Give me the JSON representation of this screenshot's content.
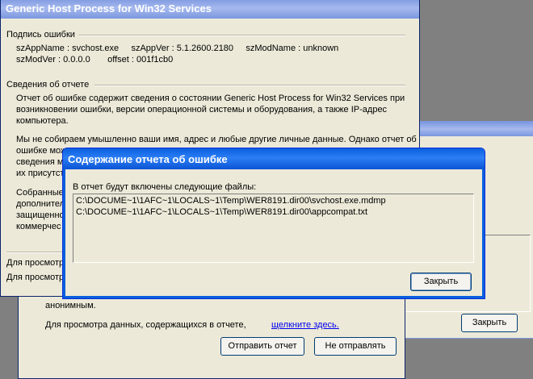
{
  "back_window_right": {
    "close_button": "Закрыть"
  },
  "middle_window": {
    "anonymous_text": "анонимным.",
    "view_data_text": "Для просмотра данных, содержащихся в отчете,",
    "click_here_link": "щелкните здесь.",
    "send_button": "Отправить отчет",
    "dont_send_button": "Не отправлять"
  },
  "main_window": {
    "title": "Generic Host Process for Win32 Services",
    "signature_header": "Подпись ошибки",
    "sig_line1": "szAppName : svchost.exe     szAppVer : 5.1.2600.2180     szModName : unknown",
    "sig_line2": "szModVer : 0.0.0.0       offset : 001f1cb0",
    "report_header": "Сведения об отчете",
    "report_p1": [
      "Отчет об ошибке содержит сведения о состоянии Generic Host Process for Win32 Services при",
      "возникновении ошибки, версии операционной системы и оборудования, а также IP-адрес",
      "компьютера."
    ],
    "report_p2": [
      "Мы не собираем умышленно ваши имя, адрес и любые другие личные данные. Однако отчет об",
      "ошибке мож",
      "сведения м",
      "их присутст"
    ],
    "report_p3": [
      "Собранные",
      "дополнител",
      "защищенно",
      "коммерчес"
    ],
    "view_line1": "Для просмотр",
    "view_line2": "Для просмотр"
  },
  "dialog": {
    "title": "Содержание отчета об ошибке",
    "files_label": "В отчет будут включены следующие файлы:",
    "files": [
      "C:\\DOCUME~1\\1AFC~1\\LOCALS~1\\Temp\\WER8191.dir00\\svchost.exe.mdmp",
      "C:\\DOCUME~1\\1AFC~1\\LOCALS~1\\Temp\\WER8191.dir00\\appcompat.txt"
    ],
    "close_button": "Закрыть"
  }
}
